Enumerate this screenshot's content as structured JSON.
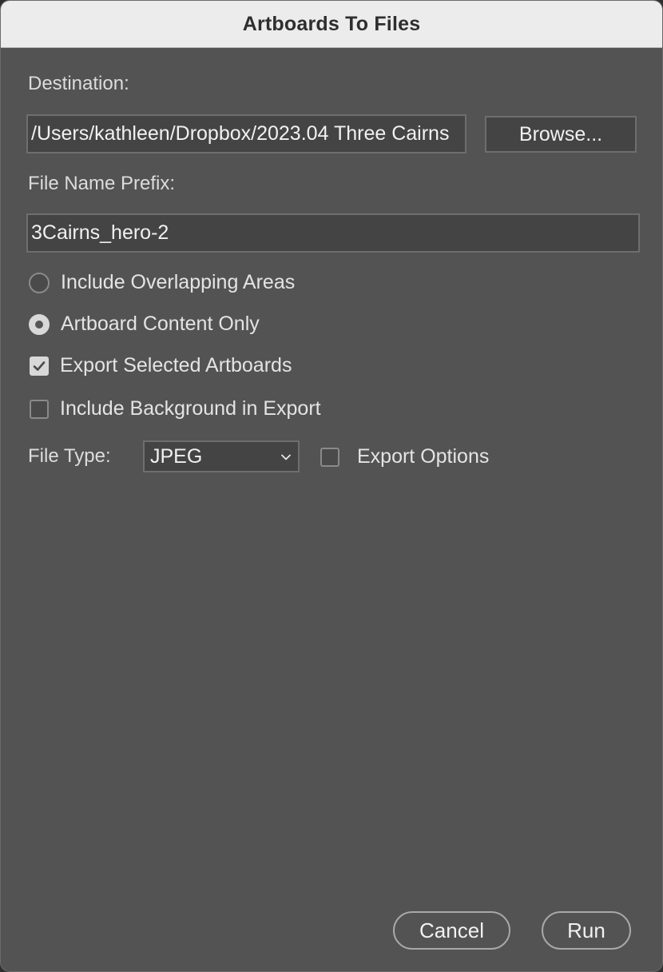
{
  "window": {
    "title": "Artboards To Files"
  },
  "destination": {
    "label": "Destination:",
    "value": "/Users/kathleen/Dropbox/2023.04 Three Cairns",
    "browse_label": "Browse..."
  },
  "prefix": {
    "label": "File Name Prefix:",
    "value": "3Cairns_hero-2"
  },
  "options": {
    "include_overlapping": {
      "label": "Include Overlapping Areas",
      "selected": false
    },
    "artboard_content_only": {
      "label": "Artboard Content Only",
      "selected": true
    },
    "export_selected": {
      "label": "Export Selected Artboards",
      "checked": true
    },
    "include_background": {
      "label": "Include Background in Export",
      "checked": false
    }
  },
  "file_type": {
    "label": "File Type:",
    "selected": "JPEG",
    "export_options_label": "Export Options",
    "export_options_checked": false
  },
  "footer": {
    "cancel_label": "Cancel",
    "run_label": "Run"
  },
  "icons": {
    "checkmark": "checkmark-icon",
    "chevron": "chevron-down-icon"
  }
}
